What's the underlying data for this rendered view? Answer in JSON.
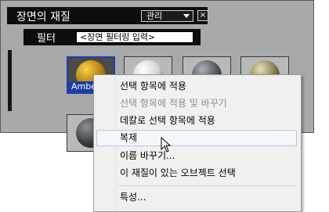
{
  "panel": {
    "title": "장면의 재질",
    "dropdown_value": "관리",
    "close_glyph": "×",
    "filter_label": "필터",
    "filter_placeholder": "<장면 필터링 입력>"
  },
  "materials": [
    {
      "label": "Ambe",
      "selected": true,
      "colors": [
        "#f6d24a",
        "#b27a0d",
        "#3a2506"
      ]
    },
    {
      "label": "",
      "selected": false,
      "colors": [
        "#ffffff",
        "#cfcfcf",
        "#202020"
      ]
    },
    {
      "label": "",
      "selected": false,
      "colors": [
        "#aab0b6",
        "#4c5258",
        "#141618"
      ]
    },
    {
      "label": "",
      "selected": false,
      "colors": [
        "#e6e0b8",
        "#7d7550",
        "#1e1c10"
      ]
    },
    {
      "label": "",
      "selected": false,
      "colors": [
        "#8c9096",
        "#3a3d41",
        "#0f1012"
      ]
    }
  ],
  "context_menu": {
    "items": [
      {
        "label": "선택 항목에 적용",
        "disabled": false
      },
      {
        "label": "선택 항목에 적용 및 바꾸기",
        "disabled": true
      },
      {
        "label": "데칼로 선택 항목에 적용",
        "disabled": false
      },
      {
        "label": "복제",
        "disabled": false,
        "hovered": true
      },
      {
        "label": "이름 바꾸기...",
        "disabled": false
      },
      {
        "label": "이 재질이 있는 오브젝트 선택",
        "disabled": false
      },
      {
        "label": "특성...",
        "disabled": false
      }
    ]
  },
  "colors": {
    "panel_bg": "#a7a9ab",
    "title_bg": "#0d0d0d",
    "selection_blue": "#1c3da5",
    "menu_bg": "#f0f0f0",
    "menu_hover_border": "#b7c7de"
  }
}
